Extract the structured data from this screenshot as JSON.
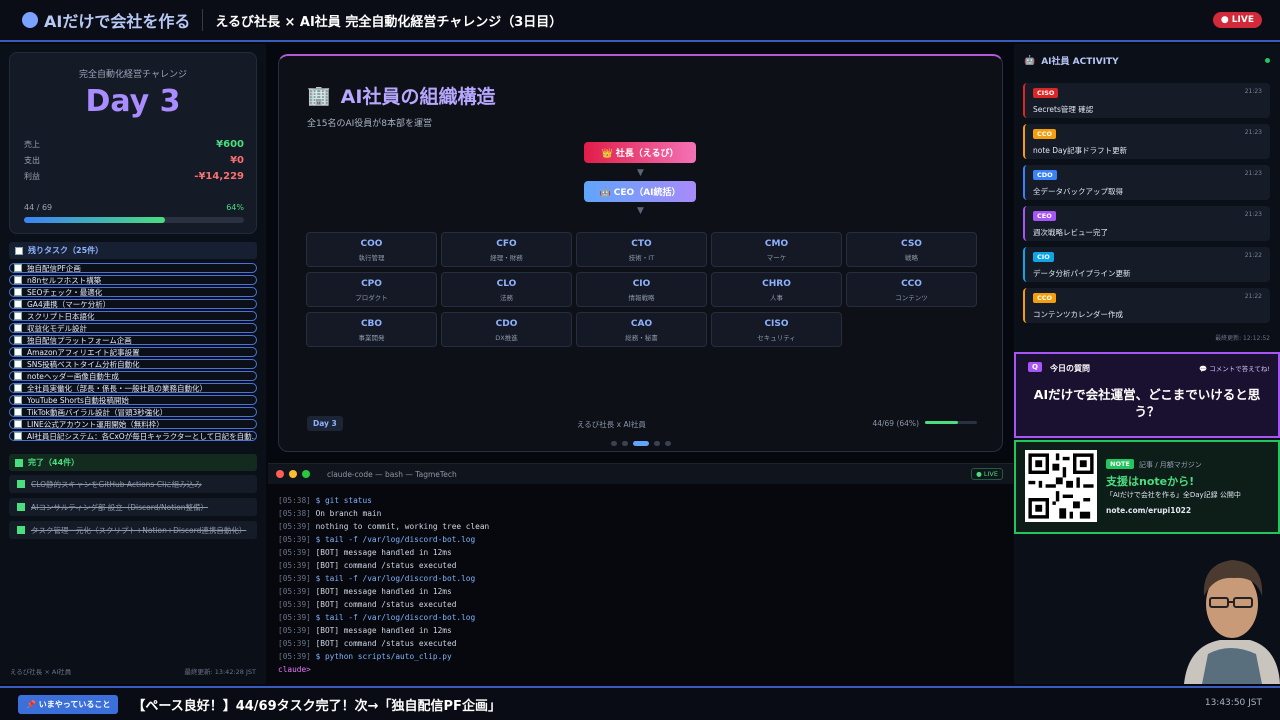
{
  "header": {
    "logo": "AIだけで会社を作る",
    "title": "えるび社長 × AI社員 完全自動化経営チャレンジ（3日目）",
    "live": "● LIVE"
  },
  "day_card": {
    "caption": "完全自動化経営チャレンジ",
    "day": "Day 3",
    "rows": [
      {
        "label": "売上",
        "value": "¥600",
        "color": "#4ade80"
      },
      {
        "label": "支出",
        "value": "¥0",
        "color": "#f87171"
      },
      {
        "label": "利益",
        "value": "-¥14,229",
        "color": "#f87171"
      }
    ],
    "progress_label": "44 / 69",
    "progress_pct": "64%",
    "progress_fraction": 0.64
  },
  "remaining": {
    "header": "残りタスク（25件）",
    "items": [
      "独自配信PF企画",
      "n8nセルフホスト構築",
      "SEOチェック・最適化",
      "GA4連携（マーケ分析）",
      "スクリプト日本語化",
      "収益化モデル設計",
      "独自配信プラットフォーム企画",
      "Amazonアフィリエイト記事設置",
      "SNS投稿ベストタイム分析自動化",
      "noteヘッダー画像自動生成",
      "全社員実働化（部長・係長・一般社員の業務自動化）",
      "YouTube Shorts自動投稿開始",
      "TikTok動画バイラル設計（冒頭3秒強化）",
      "LINE公式アカウント運用開始（無料枠）",
      "AI社員日記システム：各CxOが毎日キャラクターとして日記を自動..."
    ]
  },
  "completed": {
    "header": "完了（44件）",
    "items": [
      "CLO静的スキャンをGitHub Actions CIに組み込み",
      "AIコンサルティング部 設立（Discord/Notion整備）",
      "タスク管理一元化（スクリプト+Notion+Discord連携自動化）"
    ]
  },
  "left_footer": {
    "left": "えるび社長 × AI社員",
    "right": "最終更新: 13:42:28 JST"
  },
  "slide": {
    "icon": "🏢",
    "title": "AI社員の組織構造",
    "subtitle": "全15名のAI役員が8本部を運営",
    "president": "👑 社長（えるび）",
    "ceo": "🤖 CEO（AI統括）",
    "roles": [
      {
        "code": "COO",
        "desc": "執行管理"
      },
      {
        "code": "CFO",
        "desc": "経理・財務"
      },
      {
        "code": "CTO",
        "desc": "技術・IT"
      },
      {
        "code": "CMO",
        "desc": "マーケ"
      },
      {
        "code": "CSO",
        "desc": "戦略"
      },
      {
        "code": "CPO",
        "desc": "プロダクト"
      },
      {
        "code": "CLO",
        "desc": "法務"
      },
      {
        "code": "CIO",
        "desc": "情報戦略"
      },
      {
        "code": "CHRO",
        "desc": "人事"
      },
      {
        "code": "CCO",
        "desc": "コンテンツ"
      },
      {
        "code": "CBO",
        "desc": "事業開発"
      },
      {
        "code": "CDO",
        "desc": "DX推進"
      },
      {
        "code": "CAO",
        "desc": "総務・秘書"
      },
      {
        "code": "CISO",
        "desc": "セキュリティ"
      }
    ],
    "footer_day": "Day 3",
    "footer_center": "えるび社長 x AI社員",
    "footer_right": "44/69 (64%)",
    "progress_fraction": 0.64
  },
  "terminal": {
    "title": "claude-code — bash — TagmeTech",
    "live": "● LIVE",
    "lines": [
      {
        "t": "[05:38]",
        "x": "$ git status",
        "p": true
      },
      {
        "t": "[05:38]",
        "x": "On branch main"
      },
      {
        "t": "[05:39]",
        "x": "nothing to commit, working tree clean"
      },
      {
        "t": "[05:39]",
        "x": "$ tail -f /var/log/discord-bot.log",
        "p": true
      },
      {
        "t": "[05:39]",
        "x": "[BOT] message handled in 12ms"
      },
      {
        "t": "[05:39]",
        "x": "[BOT] command /status executed"
      },
      {
        "t": "[05:39]",
        "x": "$ tail -f /var/log/discord-bot.log",
        "p": true
      },
      {
        "t": "[05:39]",
        "x": "[BOT] message handled in 12ms"
      },
      {
        "t": "[05:39]",
        "x": "[BOT] command /status executed"
      },
      {
        "t": "[05:39]",
        "x": "$ tail -f /var/log/discord-bot.log",
        "p": true
      },
      {
        "t": "[05:39]",
        "x": "[BOT] message handled in 12ms"
      },
      {
        "t": "[05:39]",
        "x": "[BOT] command /status executed"
      },
      {
        "t": "[05:39]",
        "x": "$ python scripts/auto_clip.py",
        "p": true
      }
    ],
    "prompt": "claude>"
  },
  "activity": {
    "header": "AI社員 ACTIVITY",
    "updated": "最終更新: 12:12:52",
    "items": [
      {
        "tag": "CISO",
        "color": "#dc2626",
        "time": "21:23",
        "text": "Secrets管理 確認"
      },
      {
        "tag": "CCO",
        "color": "#f59e0b",
        "time": "21:23",
        "text": "note Day記事ドラフト更新"
      },
      {
        "tag": "CDO",
        "color": "#3b82f6",
        "time": "21:23",
        "text": "全データバックアップ取得"
      },
      {
        "tag": "CEO",
        "color": "#a855f7",
        "time": "21:23",
        "text": "週次戦略レビュー完了"
      },
      {
        "tag": "CIO",
        "color": "#0ea5e9",
        "time": "21:22",
        "text": "データ分析パイプライン更新"
      },
      {
        "tag": "CCO",
        "color": "#f59e0b",
        "time": "21:22",
        "text": "コンテンツカレンダー作成"
      }
    ]
  },
  "question": {
    "badge": "Q",
    "label": "今日の質問",
    "hint": "💬 コメントで答えてね!",
    "text": "AIだけで会社運営、どこまでいけると思う？"
  },
  "note": {
    "badge": "NOTE",
    "meta": "記事 / 月額マガジン",
    "title": "支援はnoteから!",
    "desc": "「AIだけで会社を作る」全Day記録 公開中",
    "url": "note.com/erupi1022"
  },
  "bottom": {
    "now": "📌 いまやっていること",
    "ticker": "【ペース良好！】44/69タスク完了！次→「独自配信PF企画」",
    "clock": "13:43:50 JST"
  }
}
